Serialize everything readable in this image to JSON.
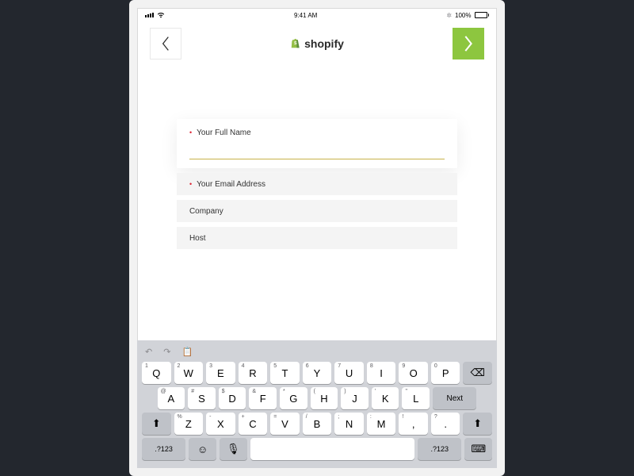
{
  "status": {
    "time": "9:41 AM",
    "battery_pct": "100%",
    "wifi_label": "wifi",
    "bt_label": "bluetooth"
  },
  "brand": {
    "name": "shopify"
  },
  "form": {
    "fullname": {
      "label": "Your Full Name",
      "value": ""
    },
    "email": {
      "label": "Your Email Address"
    },
    "company": {
      "label": "Company"
    },
    "host": {
      "label": "Host"
    }
  },
  "keyboard": {
    "row1": [
      {
        "m": "Q",
        "a": "1"
      },
      {
        "m": "W",
        "a": "2"
      },
      {
        "m": "E",
        "a": "3"
      },
      {
        "m": "R",
        "a": "4"
      },
      {
        "m": "T",
        "a": "5"
      },
      {
        "m": "Y",
        "a": "6"
      },
      {
        "m": "U",
        "a": "7"
      },
      {
        "m": "I",
        "a": "8"
      },
      {
        "m": "O",
        "a": "9"
      },
      {
        "m": "P",
        "a": "0"
      }
    ],
    "row2": [
      {
        "m": "A",
        "a": "@"
      },
      {
        "m": "S",
        "a": "#"
      },
      {
        "m": "D",
        "a": "$"
      },
      {
        "m": "F",
        "a": "&"
      },
      {
        "m": "G",
        "a": "*"
      },
      {
        "m": "H",
        "a": "("
      },
      {
        "m": "J",
        "a": ")"
      },
      {
        "m": "K",
        "a": "'"
      },
      {
        "m": "L",
        "a": "\""
      }
    ],
    "row3": [
      {
        "m": "Z",
        "a": "%"
      },
      {
        "m": "X",
        "a": "-"
      },
      {
        "m": "C",
        "a": "+"
      },
      {
        "m": "V",
        "a": "="
      },
      {
        "m": "B",
        "a": "/"
      },
      {
        "m": "N",
        "a": ";"
      },
      {
        "m": "M",
        "a": ":"
      }
    ],
    "backspace": "⌫",
    "next": "Next",
    "shift": "⇧",
    "numkey": ".?123",
    "emoji": "☺",
    "mic": "🎤",
    "hide": "⌨"
  }
}
